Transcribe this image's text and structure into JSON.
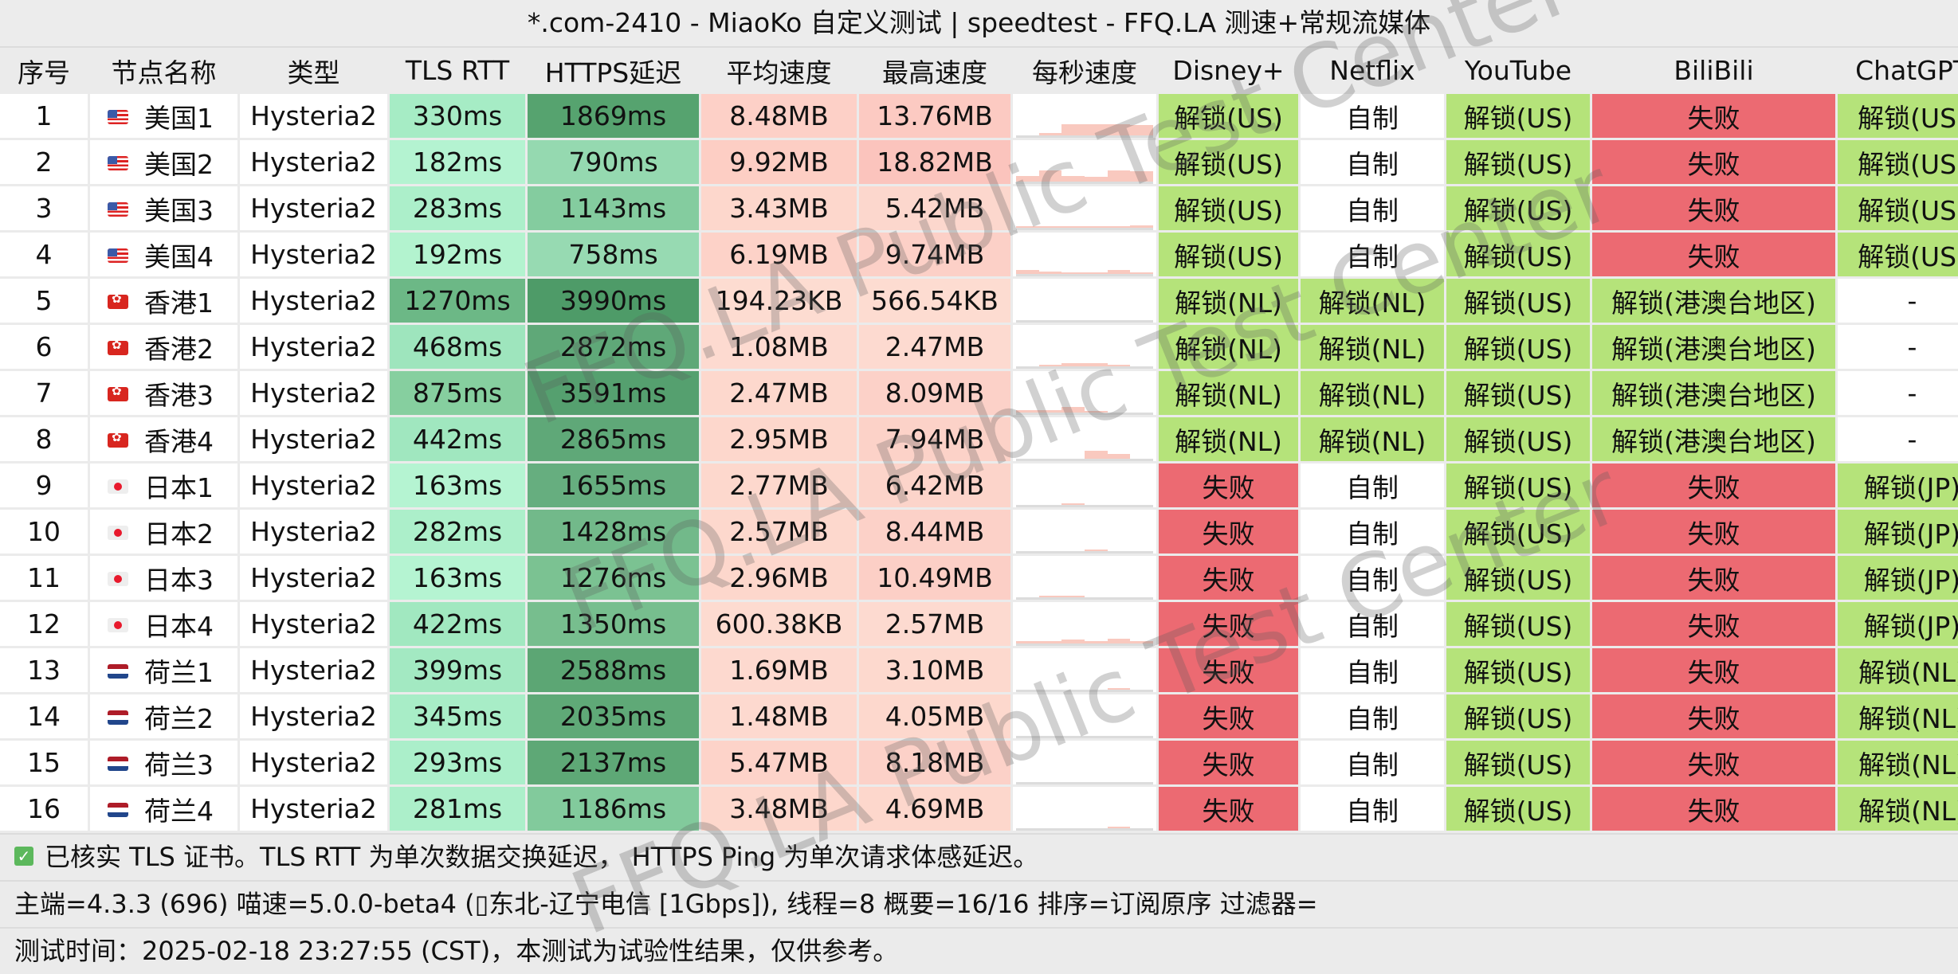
{
  "title": "*.com-2410 - MiaoKo 自定义测试 | speedtest - FFQ.LA 测速+常规流媒体",
  "columns": [
    "序号",
    "节点名称",
    "类型",
    "TLS RTT",
    "HTTPS延迟",
    "平均速度",
    "最高速度",
    "每秒速度",
    "Disney+",
    "Netflix",
    "YouTube",
    "BiliBili",
    "ChatGPT"
  ],
  "colors": {
    "unlock": "#b5e37a",
    "fail": "#ec6a72",
    "plain": "#ffffff",
    "speed_bar": "#f9c9bf"
  },
  "rows": [
    {
      "index": "1",
      "flag": "us-flag",
      "name": "美国1",
      "type": "Hysteria2",
      "tls_rtt": "330ms",
      "https": "1869ms",
      "avg": "8.48MB",
      "max": "13.76MB",
      "disney": "解锁(US)",
      "netflix": "自制",
      "youtube": "解锁(US)",
      "bilibili": "失败",
      "chatgpt": "解锁(US)",
      "tls_bg": "#a6ecc5",
      "https_bg": "#56a36f",
      "avg_bg": "#fdd0c7",
      "max_bg": "#fccac2",
      "spark": [
        0.0,
        0.2,
        1.0,
        1.0,
        1.0,
        0.95
      ]
    },
    {
      "index": "2",
      "flag": "us-flag",
      "name": "美国2",
      "type": "Hysteria2",
      "tls_rtt": "182ms",
      "https": "790ms",
      "avg": "9.92MB",
      "max": "18.82MB",
      "disney": "解锁(US)",
      "netflix": "自制",
      "youtube": "解锁(US)",
      "bilibili": "失败",
      "chatgpt": "解锁(US)",
      "tls_bg": "#b4f3d1",
      "https_bg": "#95d9b0",
      "avg_bg": "#fdcec4",
      "max_bg": "#fbc4bd",
      "spark": [
        0.5,
        1.0,
        0.5,
        0.4,
        1.0,
        0.9
      ]
    },
    {
      "index": "3",
      "flag": "us-flag",
      "name": "美国3",
      "type": "Hysteria2",
      "tls_rtt": "283ms",
      "https": "1143ms",
      "avg": "3.43MB",
      "max": "5.42MB",
      "disney": "解锁(US)",
      "netflix": "自制",
      "youtube": "解锁(US)",
      "bilibili": "失败",
      "chatgpt": "解锁(US)",
      "tls_bg": "#acefca",
      "https_bg": "#84cc9f",
      "avg_bg": "#fdd7cc",
      "max_bg": "#fcd7cd",
      "spark": [
        0.1,
        0.1,
        0.15,
        0.15,
        0.15,
        0.25
      ]
    },
    {
      "index": "4",
      "flag": "us-flag",
      "name": "美国4",
      "type": "Hysteria2",
      "tls_rtt": "192ms",
      "https": "758ms",
      "avg": "6.19MB",
      "max": "9.74MB",
      "disney": "解锁(US)",
      "netflix": "自制",
      "youtube": "解锁(US)",
      "bilibili": "失败",
      "chatgpt": "解锁(US)",
      "tls_bg": "#b3f3cf",
      "https_bg": "#97dab2",
      "avg_bg": "#fdd2c8",
      "max_bg": "#fcd0c7",
      "spark": [
        0.35,
        0.25,
        0.15,
        0.1,
        0.35,
        0.15
      ]
    },
    {
      "index": "5",
      "flag": "hk-flag",
      "name": "香港1",
      "type": "Hysteria2",
      "tls_rtt": "1270ms",
      "https": "3990ms",
      "avg": "194.23KB",
      "max": "566.54KB",
      "disney": "解锁(NL)",
      "netflix": "解锁(NL)",
      "youtube": "解锁(US)",
      "bilibili": "解锁(港澳台地区)",
      "chatgpt": "-",
      "tls_bg": "#6cb886",
      "https_bg": "#4e9b68",
      "avg_bg": "#fddcd1",
      "max_bg": "#fddcd1",
      "spark": [
        0.0,
        0.0,
        0.0,
        0.0,
        0.0,
        0.0
      ]
    },
    {
      "index": "6",
      "flag": "hk-flag",
      "name": "香港2",
      "type": "Hysteria2",
      "tls_rtt": "468ms",
      "https": "2872ms",
      "avg": "1.08MB",
      "max": "2.47MB",
      "disney": "解锁(NL)",
      "netflix": "解锁(NL)",
      "youtube": "解锁(US)",
      "bilibili": "解锁(港澳台地区)",
      "chatgpt": "-",
      "tls_bg": "#9ee5bd",
      "https_bg": "#5fa878",
      "avg_bg": "#fddad0",
      "max_bg": "#fddad0",
      "spark": [
        0.0,
        0.05,
        0.3,
        0.3,
        0.1,
        0.0
      ]
    },
    {
      "index": "7",
      "flag": "hk-flag",
      "name": "香港3",
      "type": "Hysteria2",
      "tls_rtt": "875ms",
      "https": "3591ms",
      "avg": "2.47MB",
      "max": "8.09MB",
      "disney": "解锁(NL)",
      "netflix": "解锁(NL)",
      "youtube": "解锁(US)",
      "bilibili": "解锁(港澳台地区)",
      "chatgpt": "-",
      "tls_bg": "#86cf9f",
      "https_bg": "#55a06f",
      "avg_bg": "#fdd8cd",
      "max_bg": "#fcd1c8",
      "spark": [
        0.2,
        0.25,
        0.5,
        0.1,
        0.0,
        0.0
      ]
    },
    {
      "index": "8",
      "flag": "hk-flag",
      "name": "香港4",
      "type": "Hysteria2",
      "tls_rtt": "442ms",
      "https": "2865ms",
      "avg": "2.95MB",
      "max": "7.94MB",
      "disney": "解锁(NL)",
      "netflix": "解锁(NL)",
      "youtube": "解锁(US)",
      "bilibili": "解锁(港澳台地区)",
      "chatgpt": "-",
      "tls_bg": "#a0e7bf",
      "https_bg": "#5fa878",
      "avg_bg": "#fdd7cc",
      "max_bg": "#fcd2c8",
      "spark": [
        0.0,
        0.0,
        0.0,
        0.7,
        0.45,
        0.0
      ]
    },
    {
      "index": "9",
      "flag": "jp-flag",
      "name": "日本1",
      "type": "Hysteria2",
      "tls_rtt": "163ms",
      "https": "1655ms",
      "avg": "2.77MB",
      "max": "6.42MB",
      "disney": "失败",
      "netflix": "自制",
      "youtube": "解锁(US)",
      "bilibili": "失败",
      "chatgpt": "解锁(JP)",
      "tls_bg": "#b5f4d2",
      "https_bg": "#66ae7f",
      "avg_bg": "#fdd8cd",
      "max_bg": "#fcd4ca",
      "spark": [
        0.0,
        0.0,
        0.1,
        0.0,
        0.0,
        0.0
      ]
    },
    {
      "index": "10",
      "flag": "jp-flag",
      "name": "日本2",
      "type": "Hysteria2",
      "tls_rtt": "282ms",
      "https": "1428ms",
      "avg": "2.57MB",
      "max": "8.44MB",
      "disney": "失败",
      "netflix": "自制",
      "youtube": "解锁(US)",
      "bilibili": "失败",
      "chatgpt": "解锁(JP)",
      "tls_bg": "#acefca",
      "https_bg": "#72b98a",
      "avg_bg": "#fdd8cd",
      "max_bg": "#fcd1c8",
      "spark": [
        0.0,
        0.0,
        0.0,
        0.05,
        0.0,
        0.0
      ]
    },
    {
      "index": "11",
      "flag": "jp-flag",
      "name": "日本3",
      "type": "Hysteria2",
      "tls_rtt": "163ms",
      "https": "1276ms",
      "avg": "2.96MB",
      "max": "10.49MB",
      "disney": "失败",
      "netflix": "自制",
      "youtube": "解锁(US)",
      "bilibili": "失败",
      "chatgpt": "解锁(JP)",
      "tls_bg": "#b5f4d2",
      "https_bg": "#7bc292",
      "avg_bg": "#fdd7cc",
      "max_bg": "#fccfc6",
      "spark": [
        0.0,
        0.1,
        0.05,
        0.0,
        0.0,
        0.0
      ]
    },
    {
      "index": "12",
      "flag": "jp-flag",
      "name": "日本4",
      "type": "Hysteria2",
      "tls_rtt": "422ms",
      "https": "1350ms",
      "avg": "600.38KB",
      "max": "2.57MB",
      "disney": "失败",
      "netflix": "自制",
      "youtube": "解锁(US)",
      "bilibili": "失败",
      "chatgpt": "解锁(JP)",
      "tls_bg": "#a1e8c0",
      "https_bg": "#77be8e",
      "avg_bg": "#fddbd0",
      "max_bg": "#fddad0",
      "spark": [
        0.2,
        0.2,
        0.35,
        0.2,
        0.45,
        0.2
      ]
    },
    {
      "index": "13",
      "flag": "nl-flag",
      "name": "荷兰1",
      "type": "Hysteria2",
      "tls_rtt": "399ms",
      "https": "2588ms",
      "avg": "1.69MB",
      "max": "3.10MB",
      "disney": "失败",
      "netflix": "自制",
      "youtube": "解锁(US)",
      "bilibili": "失败",
      "chatgpt": "解锁(NL)",
      "tls_bg": "#a3e9c2",
      "https_bg": "#5ca674",
      "avg_bg": "#fdd9cf",
      "max_bg": "#fdd9ce",
      "spark": [
        0.0,
        0.0,
        0.0,
        0.0,
        0.05,
        0.0
      ]
    },
    {
      "index": "14",
      "flag": "nl-flag",
      "name": "荷兰2",
      "type": "Hysteria2",
      "tls_rtt": "345ms",
      "https": "2035ms",
      "avg": "1.48MB",
      "max": "4.05MB",
      "disney": "失败",
      "netflix": "自制",
      "youtube": "解锁(US)",
      "bilibili": "失败",
      "chatgpt": "解锁(NL)",
      "tls_bg": "#a8edc7",
      "https_bg": "#5fa977",
      "avg_bg": "#fdd9cf",
      "max_bg": "#fdd8cd",
      "spark": [
        0.0,
        0.0,
        0.0,
        0.0,
        0.0,
        0.0
      ]
    },
    {
      "index": "15",
      "flag": "nl-flag",
      "name": "荷兰3",
      "type": "Hysteria2",
      "tls_rtt": "293ms",
      "https": "2137ms",
      "avg": "5.47MB",
      "max": "8.18MB",
      "disney": "失败",
      "netflix": "自制",
      "youtube": "解锁(US)",
      "bilibili": "失败",
      "chatgpt": "解锁(NL)",
      "tls_bg": "#abefca",
      "https_bg": "#5ea876",
      "avg_bg": "#fdd3c9",
      "max_bg": "#fcd1c8",
      "spark": [
        0.0,
        0.0,
        0.0,
        0.0,
        0.0,
        0.0
      ]
    },
    {
      "index": "16",
      "flag": "nl-flag",
      "name": "荷兰4",
      "type": "Hysteria2",
      "tls_rtt": "281ms",
      "https": "1186ms",
      "avg": "3.48MB",
      "max": "4.69MB",
      "disney": "失败",
      "netflix": "自制",
      "youtube": "解锁(US)",
      "bilibili": "失败",
      "chatgpt": "解锁(NL)",
      "tls_bg": "#acefca",
      "https_bg": "#82ca9c",
      "avg_bg": "#fdd7cc",
      "max_bg": "#fdd7cc",
      "spark": [
        0.0,
        0.0,
        0.0,
        0.0,
        0.05,
        0.0
      ]
    }
  ],
  "footer": {
    "check_icon": "check-icon",
    "line1": "已核实 TLS 证书。TLS RTT 为单次数据交换延迟， HTTPS Ping 为单次请求体感延迟。",
    "line2": "主端=4.3.3 (696) 喵速=5.0.0-beta4 (▯东北-辽宁电信 [1Gbps]), 线程=8 概要=16/16 排序=订阅原序 过滤器=",
    "line3": "测试时间：2025-02-18 23:27:55 (CST)，本测试为试验性结果，仅供参考。"
  },
  "watermark": "FFQ.LA Public Test Center"
}
